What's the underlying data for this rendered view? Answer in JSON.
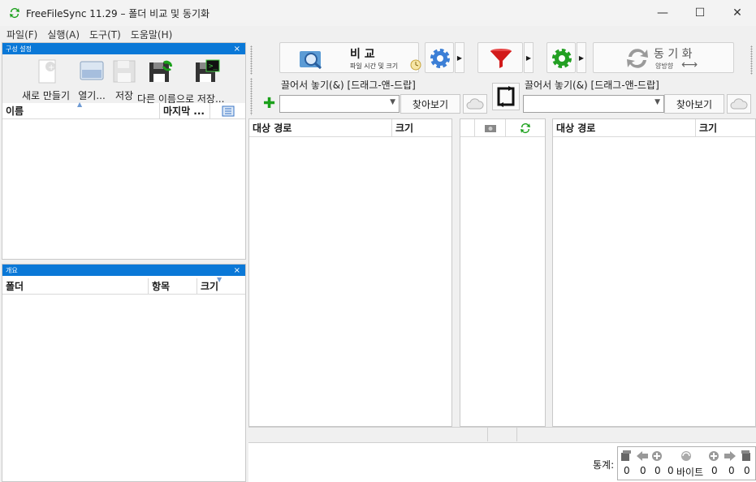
{
  "window": {
    "title": "FreeFileSync 11.29 – 폴더 비교 및 동기화",
    "minimize": "—",
    "maximize": "☐",
    "close": "✕"
  },
  "menu": [
    "파일(F)",
    "실행(A)",
    "도구(T)",
    "도움말(H)"
  ],
  "config_panel": {
    "title": "구성 설정",
    "close": "×",
    "buttons": [
      "새로 만들기",
      "열기...",
      "저장",
      "다른 이름으로 저장..."
    ],
    "columns": [
      "이름",
      "마지막 ..."
    ]
  },
  "overview_panel": {
    "title": "개요",
    "close": "×",
    "columns": [
      "폴더",
      "항목",
      "크기"
    ]
  },
  "toolbar": {
    "compare_label": "비 교",
    "compare_sub": "파일 시간 및 크기",
    "sync_label": "동 기 화",
    "sync_sub": "양방향"
  },
  "left_folder": {
    "drop_label": "끌어서 놓기(&) [드래그-앤-드랍]",
    "value": "",
    "browse": "찾아보기"
  },
  "right_folder": {
    "drop_label": "끌어서 놓기(&) [드래그-앤-드랍]",
    "value": "",
    "browse": "찾아보기"
  },
  "left_grid": {
    "columns": [
      "대상 경로",
      "크기"
    ]
  },
  "right_grid": {
    "columns": [
      "대상 경로",
      "크기"
    ]
  },
  "stats": {
    "label": "통계:",
    "values": [
      "0",
      "0",
      "0",
      "0"
    ],
    "bytes": "바이트",
    "right_values": [
      "0",
      "0",
      "0"
    ]
  },
  "colors": {
    "accent": "#0a78d7",
    "green": "#1aa01a",
    "red": "#d21a1a"
  }
}
